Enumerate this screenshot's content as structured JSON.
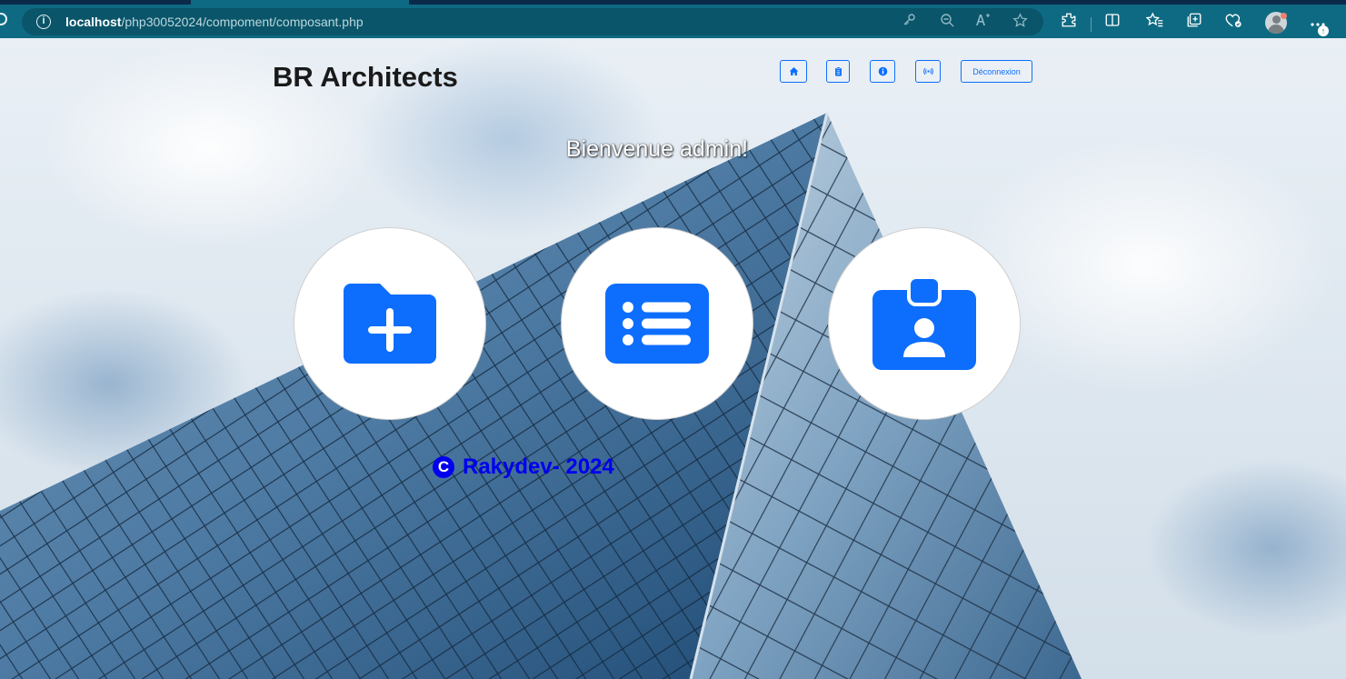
{
  "browser": {
    "url_host": "localhost",
    "url_path": "/php30052024/compoment/composant.php"
  },
  "header": {
    "brand": "BR Architects",
    "nav": [
      {
        "icon": "home-icon"
      },
      {
        "icon": "clipboard-icon"
      },
      {
        "icon": "info-icon"
      },
      {
        "icon": "broadcast-icon"
      }
    ],
    "logout_label": "Déconnexion"
  },
  "main": {
    "welcome": "Bienvenue admin!",
    "cards": [
      {
        "icon": "folder-plus-icon"
      },
      {
        "icon": "list-icon"
      },
      {
        "icon": "person-badge-icon"
      }
    ]
  },
  "footer": {
    "copyright_symbol": "C",
    "text": "Rakydev- 2024"
  },
  "colors": {
    "accent": "#0d6efd",
    "footer_text": "#0000ee",
    "browser_toolbar": "#0e6a83"
  }
}
